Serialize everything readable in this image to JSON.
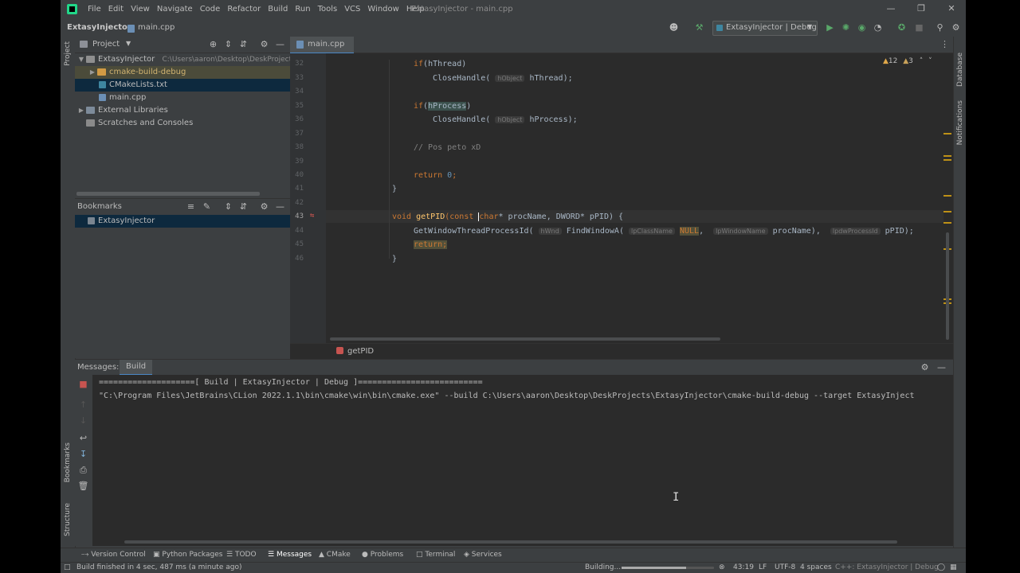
{
  "menu": [
    "File",
    "Edit",
    "View",
    "Navigate",
    "Code",
    "Refactor",
    "Build",
    "Run",
    "Tools",
    "VCS",
    "Window",
    "Help"
  ],
  "window_title": "ExtasyInjector - main.cpp",
  "nav": {
    "project": "ExtasyInjector",
    "file": "main.cpp",
    "run_config": "ExtasyInjector | Debug"
  },
  "project_panel": {
    "title": "Project",
    "root": {
      "name": "ExtasyInjector",
      "path": "C:\\Users\\aaron\\Desktop\\DeskProjects\\Ext"
    },
    "items": [
      "cmake-build-debug",
      "CMakeLists.txt",
      "main.cpp",
      "External Libraries",
      "Scratches and Consoles"
    ]
  },
  "bookmarks_panel": {
    "title": "Bookmarks",
    "items": [
      "ExtasyInjector"
    ]
  },
  "editor": {
    "tab": "main.cpp",
    "warnings": "12",
    "weak_warnings": "3",
    "breadcrumb": "getPID",
    "line_numbers": [
      "32",
      "33",
      "34",
      "35",
      "36",
      "37",
      "38",
      "39",
      "40",
      "41",
      "42",
      "43",
      "44",
      "45",
      "46"
    ],
    "hints": {
      "hObject": "hObject",
      "hWnd": "hWnd",
      "lpClassName": "lpClassName",
      "lpWindowName": "lpWindowName",
      "lpdwProcessId": "lpdwProcessId"
    },
    "code": {
      "if_kw": "if",
      "if1_open": "(",
      "if1_arg": "hThread",
      "if1_close": ")",
      "close_handle": "CloseHandle(",
      "arg_thread": "hThread);",
      "if2_arg": "hProcess",
      "arg_process": "hProcess);",
      "comment": "// Pos peto xD",
      "return_kw": "return",
      "zero": "0",
      "semi": ";",
      "brace_close": "}",
      "void_kw": "void",
      "fn_name": "getPID",
      "const_kw": "(const ",
      "char_kw": "char",
      "sig_rest": "* procName, DWORD* pPID) {",
      "gwtp": "GetWindowThreadProcessId(",
      "fwa": "FindWindowA(",
      "null_kw": "NULL",
      "comma": ",",
      "procname": "procName),",
      "ppid": "pPID);",
      "ret2": "return;"
    }
  },
  "build": {
    "tab_messages": "Messages:",
    "tab_build": "Build",
    "output": [
      "====================[ Build | ExtasyInjector | Debug ]==========================",
      "\"C:\\Program Files\\JetBrains\\CLion 2022.1.1\\bin\\cmake\\win\\bin\\cmake.exe\" --build C:\\Users\\aaron\\Desktop\\DeskProjects\\ExtasyInjector\\cmake-build-debug --target ExtasyInject"
    ]
  },
  "tool_tabs": [
    "Version Control",
    "Python Packages",
    "TODO",
    "Messages",
    "CMake",
    "Problems",
    "Terminal",
    "Services"
  ],
  "side_labels": {
    "project": "Project",
    "bookmarks": "Bookmarks",
    "structure": "Structure",
    "database": "Database",
    "notifications": "Notifications"
  },
  "status": {
    "message": "Build finished in 4 sec, 487 ms (a minute ago)",
    "building": "Building...",
    "progress": 0.7,
    "position": "43:19",
    "line_sep": "LF",
    "encoding": "UTF-8",
    "indent": "4 spaces",
    "context": "C++: ExtasyInjector | Debug"
  }
}
